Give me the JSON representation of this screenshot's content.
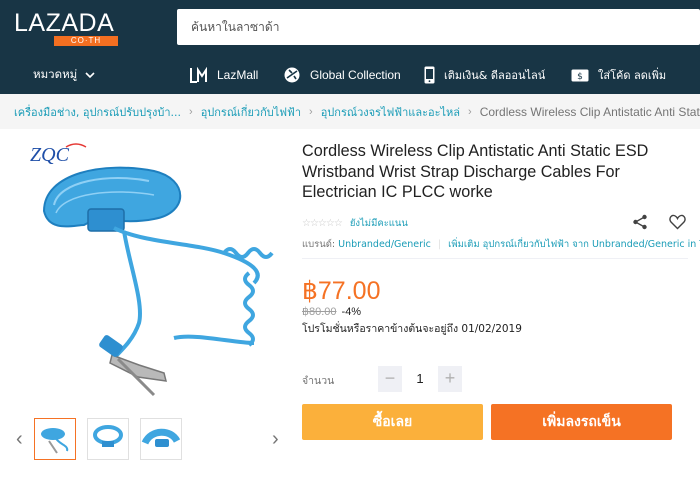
{
  "header": {
    "logo_main": "LAZADA",
    "logo_sub": "CO·TH",
    "search_placeholder": "ค้นหาในลาซาด้า",
    "brand_color": "#183545",
    "accent_color": "#f36f21"
  },
  "nav": {
    "categories_label": "หมวดหมู่",
    "items": [
      {
        "label": "LazMall",
        "icon": "lazmall-icon"
      },
      {
        "label": "Global Collection",
        "icon": "airplane-globe-icon"
      },
      {
        "label": "เติมเงิน& ดีลออนไลน์",
        "icon": "mobile-phone-icon"
      },
      {
        "label": "ใส่โค้ด ลดเพิ่ม",
        "icon": "coupon-icon"
      }
    ]
  },
  "breadcrumb": [
    "เครื่องมือช่าง, อุปกรณ์ปรับปรุงบ้า...",
    "อุปกรณ์เกี่ยวกับไฟฟ้า",
    "อุปกรณ์วงจรไฟฟ้าและอะไหล่",
    "Cordless Wireless Clip Antistatic Anti Static ESD"
  ],
  "gallery": {
    "watermark": "ZQC",
    "thumbnails": [
      "wrist-strap-coiled",
      "wrist-strap-band",
      "wrist-strap-closeup"
    ]
  },
  "product": {
    "title": "Cordless Wireless Clip Antistatic Anti Static ESD Wristband Wrist Strap Discharge Cables For Electrician IC PLCC worke",
    "rating_text": "ยังไม่มีคะแนน",
    "brand_label": "แบรนด์:",
    "brand_value": "Unbranded/Generic",
    "more_link": "เพิ่มเติม อุปกรณ์เกี่ยวกับไฟฟ้า จาก Unbranded/Generic in TH",
    "price": "฿77.00",
    "original_price": "฿80.00",
    "discount": "-4%",
    "promo": "โปรโมชั่นหรือราคาข้างต้นจะอยู่ถึง 01/02/2019",
    "price_color": "#f57224"
  },
  "quantity": {
    "label": "จำนวน",
    "minus": "−",
    "value": "1",
    "plus": "+"
  },
  "actions": {
    "buy_now": "ซื้อเลย",
    "add_to_cart": "เพิ่มลงรถเข็น",
    "buy_color": "#fbb03b",
    "cart_color": "#f57224"
  }
}
